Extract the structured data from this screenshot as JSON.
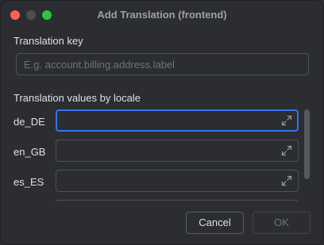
{
  "window": {
    "title": "Add Translation (frontend)"
  },
  "translation_key": {
    "label": "Translation key",
    "value": "",
    "placeholder": "E.g. account.billing.address.label"
  },
  "values_section": {
    "label": "Translation values by locale",
    "locales": [
      {
        "code": "de_DE",
        "value": "",
        "focused": true
      },
      {
        "code": "en_GB",
        "value": "",
        "focused": false
      },
      {
        "code": "es_ES",
        "value": "",
        "focused": false
      }
    ]
  },
  "buttons": {
    "cancel": "Cancel",
    "ok": "OK"
  },
  "colors": {
    "background": "#2b2d30",
    "focus_accent": "#3574f0",
    "close": "#ff5f57",
    "maximize": "#28c840"
  },
  "icons": {
    "expand": "expand-arrows-icon"
  }
}
